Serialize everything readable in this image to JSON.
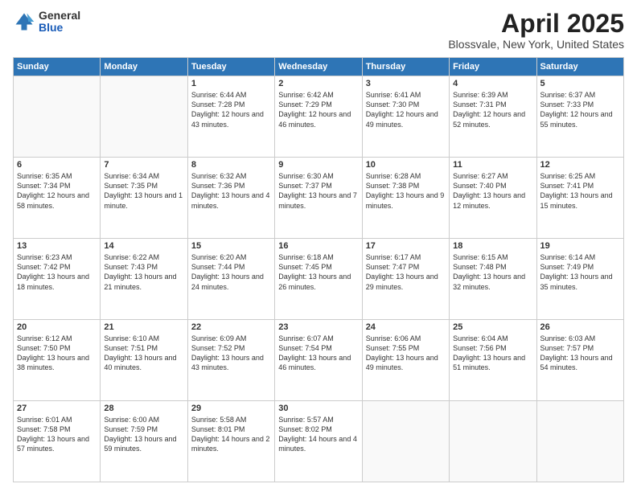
{
  "header": {
    "logo_general": "General",
    "logo_blue": "Blue",
    "title": "April 2025",
    "subtitle": "Blossvale, New York, United States"
  },
  "days_of_week": [
    "Sunday",
    "Monday",
    "Tuesday",
    "Wednesday",
    "Thursday",
    "Friday",
    "Saturday"
  ],
  "weeks": [
    [
      {
        "day": "",
        "info": ""
      },
      {
        "day": "",
        "info": ""
      },
      {
        "day": "1",
        "info": "Sunrise: 6:44 AM\nSunset: 7:28 PM\nDaylight: 12 hours and 43 minutes."
      },
      {
        "day": "2",
        "info": "Sunrise: 6:42 AM\nSunset: 7:29 PM\nDaylight: 12 hours and 46 minutes."
      },
      {
        "day": "3",
        "info": "Sunrise: 6:41 AM\nSunset: 7:30 PM\nDaylight: 12 hours and 49 minutes."
      },
      {
        "day": "4",
        "info": "Sunrise: 6:39 AM\nSunset: 7:31 PM\nDaylight: 12 hours and 52 minutes."
      },
      {
        "day": "5",
        "info": "Sunrise: 6:37 AM\nSunset: 7:33 PM\nDaylight: 12 hours and 55 minutes."
      }
    ],
    [
      {
        "day": "6",
        "info": "Sunrise: 6:35 AM\nSunset: 7:34 PM\nDaylight: 12 hours and 58 minutes."
      },
      {
        "day": "7",
        "info": "Sunrise: 6:34 AM\nSunset: 7:35 PM\nDaylight: 13 hours and 1 minute."
      },
      {
        "day": "8",
        "info": "Sunrise: 6:32 AM\nSunset: 7:36 PM\nDaylight: 13 hours and 4 minutes."
      },
      {
        "day": "9",
        "info": "Sunrise: 6:30 AM\nSunset: 7:37 PM\nDaylight: 13 hours and 7 minutes."
      },
      {
        "day": "10",
        "info": "Sunrise: 6:28 AM\nSunset: 7:38 PM\nDaylight: 13 hours and 9 minutes."
      },
      {
        "day": "11",
        "info": "Sunrise: 6:27 AM\nSunset: 7:40 PM\nDaylight: 13 hours and 12 minutes."
      },
      {
        "day": "12",
        "info": "Sunrise: 6:25 AM\nSunset: 7:41 PM\nDaylight: 13 hours and 15 minutes."
      }
    ],
    [
      {
        "day": "13",
        "info": "Sunrise: 6:23 AM\nSunset: 7:42 PM\nDaylight: 13 hours and 18 minutes."
      },
      {
        "day": "14",
        "info": "Sunrise: 6:22 AM\nSunset: 7:43 PM\nDaylight: 13 hours and 21 minutes."
      },
      {
        "day": "15",
        "info": "Sunrise: 6:20 AM\nSunset: 7:44 PM\nDaylight: 13 hours and 24 minutes."
      },
      {
        "day": "16",
        "info": "Sunrise: 6:18 AM\nSunset: 7:45 PM\nDaylight: 13 hours and 26 minutes."
      },
      {
        "day": "17",
        "info": "Sunrise: 6:17 AM\nSunset: 7:47 PM\nDaylight: 13 hours and 29 minutes."
      },
      {
        "day": "18",
        "info": "Sunrise: 6:15 AM\nSunset: 7:48 PM\nDaylight: 13 hours and 32 minutes."
      },
      {
        "day": "19",
        "info": "Sunrise: 6:14 AM\nSunset: 7:49 PM\nDaylight: 13 hours and 35 minutes."
      }
    ],
    [
      {
        "day": "20",
        "info": "Sunrise: 6:12 AM\nSunset: 7:50 PM\nDaylight: 13 hours and 38 minutes."
      },
      {
        "day": "21",
        "info": "Sunrise: 6:10 AM\nSunset: 7:51 PM\nDaylight: 13 hours and 40 minutes."
      },
      {
        "day": "22",
        "info": "Sunrise: 6:09 AM\nSunset: 7:52 PM\nDaylight: 13 hours and 43 minutes."
      },
      {
        "day": "23",
        "info": "Sunrise: 6:07 AM\nSunset: 7:54 PM\nDaylight: 13 hours and 46 minutes."
      },
      {
        "day": "24",
        "info": "Sunrise: 6:06 AM\nSunset: 7:55 PM\nDaylight: 13 hours and 49 minutes."
      },
      {
        "day": "25",
        "info": "Sunrise: 6:04 AM\nSunset: 7:56 PM\nDaylight: 13 hours and 51 minutes."
      },
      {
        "day": "26",
        "info": "Sunrise: 6:03 AM\nSunset: 7:57 PM\nDaylight: 13 hours and 54 minutes."
      }
    ],
    [
      {
        "day": "27",
        "info": "Sunrise: 6:01 AM\nSunset: 7:58 PM\nDaylight: 13 hours and 57 minutes."
      },
      {
        "day": "28",
        "info": "Sunrise: 6:00 AM\nSunset: 7:59 PM\nDaylight: 13 hours and 59 minutes."
      },
      {
        "day": "29",
        "info": "Sunrise: 5:58 AM\nSunset: 8:01 PM\nDaylight: 14 hours and 2 minutes."
      },
      {
        "day": "30",
        "info": "Sunrise: 5:57 AM\nSunset: 8:02 PM\nDaylight: 14 hours and 4 minutes."
      },
      {
        "day": "",
        "info": ""
      },
      {
        "day": "",
        "info": ""
      },
      {
        "day": "",
        "info": ""
      }
    ]
  ]
}
